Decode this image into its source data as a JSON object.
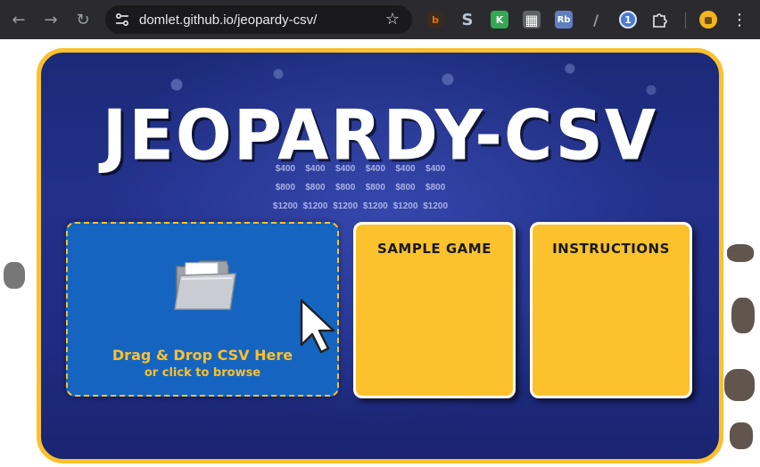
{
  "browser": {
    "url": "domlet.github.io/jeopardy-csv/",
    "back_icon": "←",
    "forward_icon": "→",
    "reload_icon": "↻",
    "star_icon": "☆",
    "menu_icon": "⋮",
    "extensions": [
      {
        "name": "extension-orange-icon",
        "glyph": "b",
        "color": "#e8710a"
      },
      {
        "name": "extension-s-icon",
        "glyph": "S",
        "color": "#8a9bb0"
      },
      {
        "name": "extension-k-icon",
        "glyph": "K",
        "color": "#34a853"
      },
      {
        "name": "extension-qr-icon",
        "glyph": "▦",
        "color": "#9e9e9e"
      },
      {
        "name": "extension-rb-icon",
        "glyph": "Rb",
        "color": "#5f7fbf"
      },
      {
        "name": "extension-pen-icon",
        "glyph": "/",
        "color": "#444"
      },
      {
        "name": "extension-1password-icon",
        "glyph": "1",
        "color": "#4a7bd0"
      }
    ]
  },
  "page": {
    "title": "JEOPARDY-CSV",
    "board_values": [
      "$400",
      "$400",
      "$400",
      "$400",
      "$400",
      "$400",
      "$800",
      "$800",
      "$800",
      "$800",
      "$800",
      "$800",
      "$1200",
      "$1200",
      "$1200",
      "$1200",
      "$1200",
      "$1200"
    ],
    "dropzone": {
      "title": "Drag & Drop CSV Here",
      "subtitle": "or click to browse"
    },
    "sample_game_label": "SAMPLE GAME",
    "instructions_label": "INSTRUCTIONS"
  },
  "colors": {
    "accent_yellow": "#fbc02d",
    "board_blue": "#1b2a78",
    "dropzone_blue": "#1565c0"
  }
}
